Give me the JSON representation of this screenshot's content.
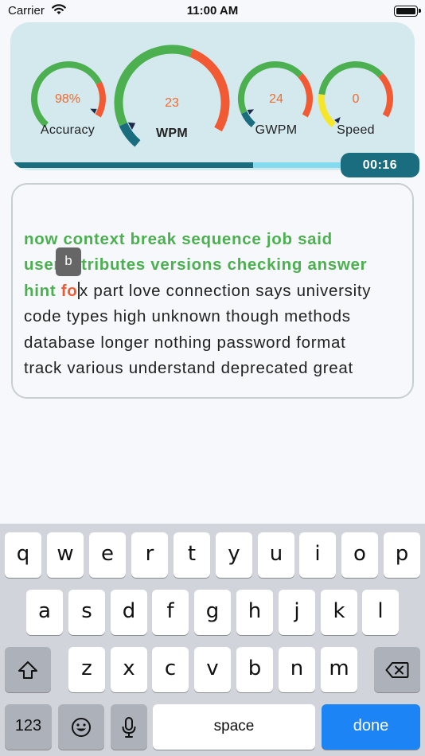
{
  "status_bar": {
    "carrier": "Carrier",
    "time": "11:00 AM"
  },
  "gauges": [
    {
      "id": "accuracy",
      "label": "Accuracy",
      "value": "98%",
      "needle_fraction": 0.98
    },
    {
      "id": "wpm",
      "label": "WPM",
      "value": "23",
      "needle_fraction": 0.08
    },
    {
      "id": "gwpm",
      "label": "GWPM",
      "value": "24",
      "needle_fraction": 0.09
    },
    {
      "id": "speed",
      "label": "Speed",
      "value": "0",
      "needle_fraction": 0.0
    }
  ],
  "progress": {
    "fraction": 0.6
  },
  "timer": "00:16",
  "typing_text": {
    "typed_lines": [
      "now context break sequence job said",
      "user attributes versions checking answer"
    ],
    "line3_typed": "hint ",
    "line3_error": "fo",
    "line3_rest": "x part love connection says university",
    "pending_lines": [
      "code types high unknown though methods",
      "database longer nothing password format",
      "track various understand deprecated great"
    ]
  },
  "key_popup": "b",
  "keyboard": {
    "row1": [
      "q",
      "w",
      "e",
      "r",
      "t",
      "y",
      "u",
      "i",
      "o",
      "p"
    ],
    "row2": [
      "a",
      "s",
      "d",
      "f",
      "g",
      "h",
      "j",
      "k",
      "l"
    ],
    "row3": [
      "z",
      "x",
      "c",
      "v",
      "b",
      "n",
      "m"
    ],
    "numbers_label": "123",
    "space_label": "space",
    "done_label": "done"
  },
  "colors": {
    "accent_teal": "#1a6d7e",
    "good_green": "#4caf50",
    "warn_yellow": "#f5e62a",
    "bad_orange": "#f25a33",
    "done_blue": "#1d84f5"
  }
}
